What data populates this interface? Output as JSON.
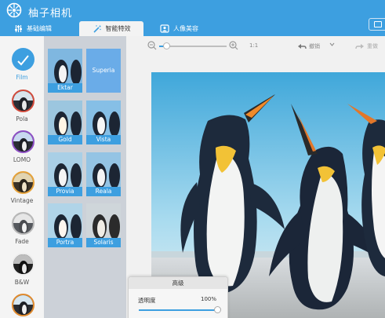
{
  "app": {
    "title": "柚子相机"
  },
  "tabs": [
    {
      "label": "基础编辑",
      "active": false
    },
    {
      "label": "智能特效",
      "active": true
    },
    {
      "label": "人像美容",
      "active": false
    }
  ],
  "categories": [
    {
      "label": "Film",
      "active": true
    },
    {
      "label": "Pola"
    },
    {
      "label": "LOMO"
    },
    {
      "label": "Vintage"
    },
    {
      "label": "Fade"
    },
    {
      "label": "B&W"
    },
    {
      "label": ""
    }
  ],
  "filters": [
    {
      "label": "Ektar"
    },
    {
      "label": "Superia",
      "selected": true
    },
    {
      "label": "Gold"
    },
    {
      "label": "Vista"
    },
    {
      "label": "Provia"
    },
    {
      "label": "Reala"
    },
    {
      "label": "Portra"
    },
    {
      "label": "Solaris"
    }
  ],
  "toolbar": {
    "zoom_ratio": "1:1",
    "zoom_level": 0.1,
    "undo_label": "撤销",
    "redo_label": "重做"
  },
  "advanced_panel": {
    "title": "高级",
    "opacity_label": "透明度",
    "opacity_value": "100%",
    "opacity_level": 1.0
  },
  "colors": {
    "accent": "#3d9fe0"
  }
}
